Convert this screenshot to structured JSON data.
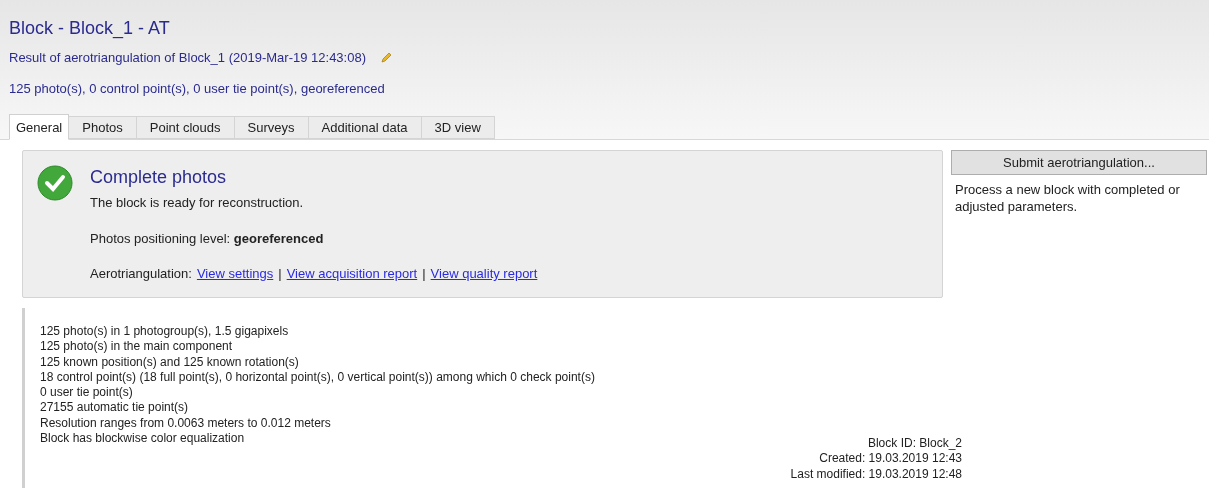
{
  "header": {
    "title": "Block - Block_1 - AT",
    "subtitle": "Result of aerotriangulation of Block_1 (2019-Mar-19 12:43:08)",
    "summary": "125 photo(s), 0 control point(s), 0 user tie point(s), georeferenced"
  },
  "tabs": [
    {
      "label": "General",
      "selected": true
    },
    {
      "label": "Photos",
      "selected": false
    },
    {
      "label": "Point clouds",
      "selected": false
    },
    {
      "label": "Surveys",
      "selected": false
    },
    {
      "label": "Additional data",
      "selected": false
    },
    {
      "label": "3D view",
      "selected": false
    }
  ],
  "status": {
    "heading": "Complete photos",
    "message": "The block is ready for reconstruction.",
    "positioning": "Photos positioning level: **georeferenced**",
    "aerotriangulation_label": "Aerotriangulation:",
    "separator": "|",
    "links": [
      "View settings",
      "View acquisition report",
      "View quality report"
    ]
  },
  "action": {
    "button": "Submit aerotriangulation...",
    "description": "Process a new block with completed or adjusted parameters."
  },
  "stats": [
    "125 photo(s) in 1 photogroup(s), 1.5 gigapixels",
    "125 photo(s) in the main component",
    "125 known position(s) and 125 known rotation(s)",
    "18 control point(s) (18 full point(s), 0 horizontal point(s), 0 vertical point(s)) among which 0 check point(s)",
    "0 user tie point(s)",
    "27155 automatic tie point(s)",
    "Resolution ranges from 0.0063 meters to 0.012 meters",
    "Block has blockwise color equalization"
  ],
  "info": [
    "Block ID: Block_2",
    "Created: 19.03.2019 12:43",
    "Last modified: 19.03.2019 12:48"
  ]
}
